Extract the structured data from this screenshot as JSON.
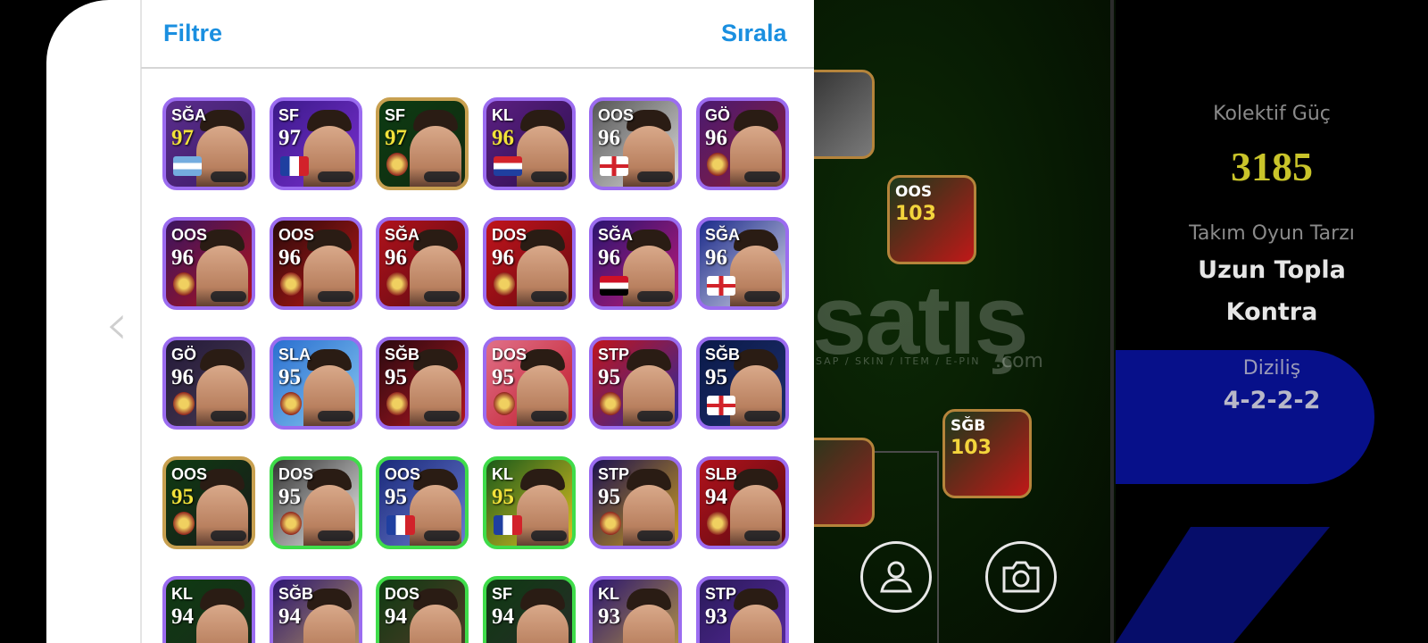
{
  "header": {
    "filter_label": "Filtre",
    "sort_label": "Sırala"
  },
  "team_stats": {
    "strength_label": "Kolektif Güç",
    "strength_value": "3185",
    "playstyle_label": "Takım Oyun Tarzı",
    "playstyle_line1": "Uzun Topla",
    "playstyle_line2": "Kontra",
    "formation_label": "Diziliş",
    "formation_value": "4-2-2-2"
  },
  "watermark": {
    "text": "satış",
    "sub": "SAP / SKIN / ITEM / E-PIN",
    "suffix": ".com"
  },
  "field_players": [
    {
      "position": "OOS",
      "rating": "103"
    },
    {
      "position": "SĞB",
      "rating": "103"
    }
  ],
  "icons": {
    "back": "chevron-left-icon",
    "profile": "user-icon",
    "camera": "camera-icon"
  },
  "colors": {
    "accent": "#1a8fe0",
    "gold_rating": "#f2e23a",
    "strength": "#c9c42a",
    "panel_blue": "#07108a"
  },
  "players": [
    {
      "position": "SĞA",
      "rating": "97",
      "gold": true,
      "border": "#9b6cf0",
      "bg": "#5a2d8c,#3b1b66",
      "badge": "flag-argentina"
    },
    {
      "position": "SF",
      "rating": "97",
      "gold": false,
      "border": "#9b6cf0",
      "bg": "#3b1a8a,#7b2fd1",
      "badge": "flag-france"
    },
    {
      "position": "SF",
      "rating": "97",
      "gold": true,
      "border": "#c8a050",
      "bg": "#0c3b12,#122a10",
      "badge": "crest-galatasaray"
    },
    {
      "position": "KL",
      "rating": "96",
      "gold": true,
      "border": "#9b6cf0",
      "bg": "#5b1f82,#2c0f4d",
      "badge": "flag-croatia"
    },
    {
      "position": "OOS",
      "rating": "96",
      "gold": false,
      "border": "#9b6cf0",
      "bg": "#555,#ddd",
      "badge": "flag-england"
    },
    {
      "position": "GÖ",
      "rating": "96",
      "gold": false,
      "border": "#9b6cf0",
      "bg": "#4a1a70,#8c1c3a",
      "badge": "crest-barcelona"
    },
    {
      "position": "OOS",
      "rating": "96",
      "gold": false,
      "border": "#9b6cf0",
      "bg": "#3a1460,#b0121b",
      "badge": "crest-bayern"
    },
    {
      "position": "OOS",
      "rating": "96",
      "gold": false,
      "border": "#9b6cf0",
      "bg": "#2a0a0a,#c01818",
      "badge": "crest-leverkusen"
    },
    {
      "position": "SĞA",
      "rating": "96",
      "gold": false,
      "border": "#9b6cf0",
      "bg": "#b0121b,#5a0a12",
      "badge": "crest-arsenal"
    },
    {
      "position": "DOS",
      "rating": "96",
      "gold": false,
      "border": "#9b6cf0",
      "bg": "#c0141c,#6a0a10",
      "badge": "crest-arsenal"
    },
    {
      "position": "SĞA",
      "rating": "96",
      "gold": false,
      "border": "#9b6cf0",
      "bg": "#2a1470,#c01a7a",
      "badge": "flag-egypt"
    },
    {
      "position": "SĞA",
      "rating": "96",
      "gold": false,
      "border": "#9b6cf0",
      "bg": "#1a2a8a,#d8d8e8",
      "badge": "flag-england"
    },
    {
      "position": "GÖ",
      "rating": "96",
      "gold": false,
      "border": "#9b6cf0",
      "bg": "#231a3a,#4a3a50",
      "badge": "crest-arsenal"
    },
    {
      "position": "SLA",
      "rating": "95",
      "gold": false,
      "border": "#9b6cf0",
      "bg": "#2a6fd0,#87c8f0",
      "badge": "crest-inter-miami"
    },
    {
      "position": "SĞB",
      "rating": "95",
      "gold": false,
      "border": "#9b6cf0",
      "bg": "#2b0a10,#b01520",
      "badge": "crest-milan"
    },
    {
      "position": "DOS",
      "rating": "95",
      "gold": false,
      "border": "#9b6cf0",
      "bg": "#e07088,#c01a2a",
      "badge": "crest-bayern"
    },
    {
      "position": "STP",
      "rating": "95",
      "gold": false,
      "border": "#9b6cf0",
      "bg": "#c0141c,#2a2aa0",
      "badge": "crest-arsenal"
    },
    {
      "position": "SĞB",
      "rating": "95",
      "gold": false,
      "border": "#9b6cf0",
      "bg": "#0a1a4a,#1e2e6a",
      "badge": "flag-england"
    },
    {
      "position": "OOS",
      "rating": "95",
      "gold": true,
      "border": "#c8a050",
      "bg": "#0e3a12,#1a1a1a",
      "badge": "crest-eintracht"
    },
    {
      "position": "DOS",
      "rating": "95",
      "gold": false,
      "border": "#3fdc4a",
      "bg": "#333,#f0f0f0",
      "badge": "crest-juventus"
    },
    {
      "position": "OOS",
      "rating": "95",
      "gold": false,
      "border": "#3fdc4a",
      "bg": "#1a2a7a,#6a7ad0",
      "badge": "flag-france"
    },
    {
      "position": "KL",
      "rating": "95",
      "gold": true,
      "border": "#3fdc4a",
      "bg": "#1a5a1a,#e0c020",
      "badge": "flag-france"
    },
    {
      "position": "STP",
      "rating": "95",
      "gold": false,
      "border": "#9b6cf0",
      "bg": "#1a1050,#d0a020",
      "badge": "crest-inter"
    },
    {
      "position": "SLB",
      "rating": "94",
      "gold": false,
      "border": "#9b6cf0",
      "bg": "#b0121b,#5a0a12",
      "badge": "crest-milan"
    },
    {
      "position": "KL",
      "rating": "94",
      "gold": false,
      "border": "#9b6cf0",
      "bg": "#0e3a12,#1a2a1a",
      "badge": "none"
    },
    {
      "position": "SĞB",
      "rating": "94",
      "gold": false,
      "border": "#9b6cf0",
      "bg": "#2a1470,#c0a060",
      "badge": "none"
    },
    {
      "position": "DOS",
      "rating": "94",
      "gold": false,
      "border": "#3fdc4a",
      "bg": "#0e3a12,#5a3a2a",
      "badge": "none"
    },
    {
      "position": "SF",
      "rating": "94",
      "gold": false,
      "border": "#3fdc4a",
      "bg": "#0e3a12,#2a2a2a",
      "badge": "none"
    },
    {
      "position": "KL",
      "rating": "93",
      "gold": false,
      "border": "#9b6cf0",
      "bg": "#2a1470,#c0a040",
      "badge": "none"
    },
    {
      "position": "STP",
      "rating": "93",
      "gold": false,
      "border": "#9b6cf0",
      "bg": "#2a1a5a,#5a2aa0",
      "badge": "none"
    }
  ]
}
